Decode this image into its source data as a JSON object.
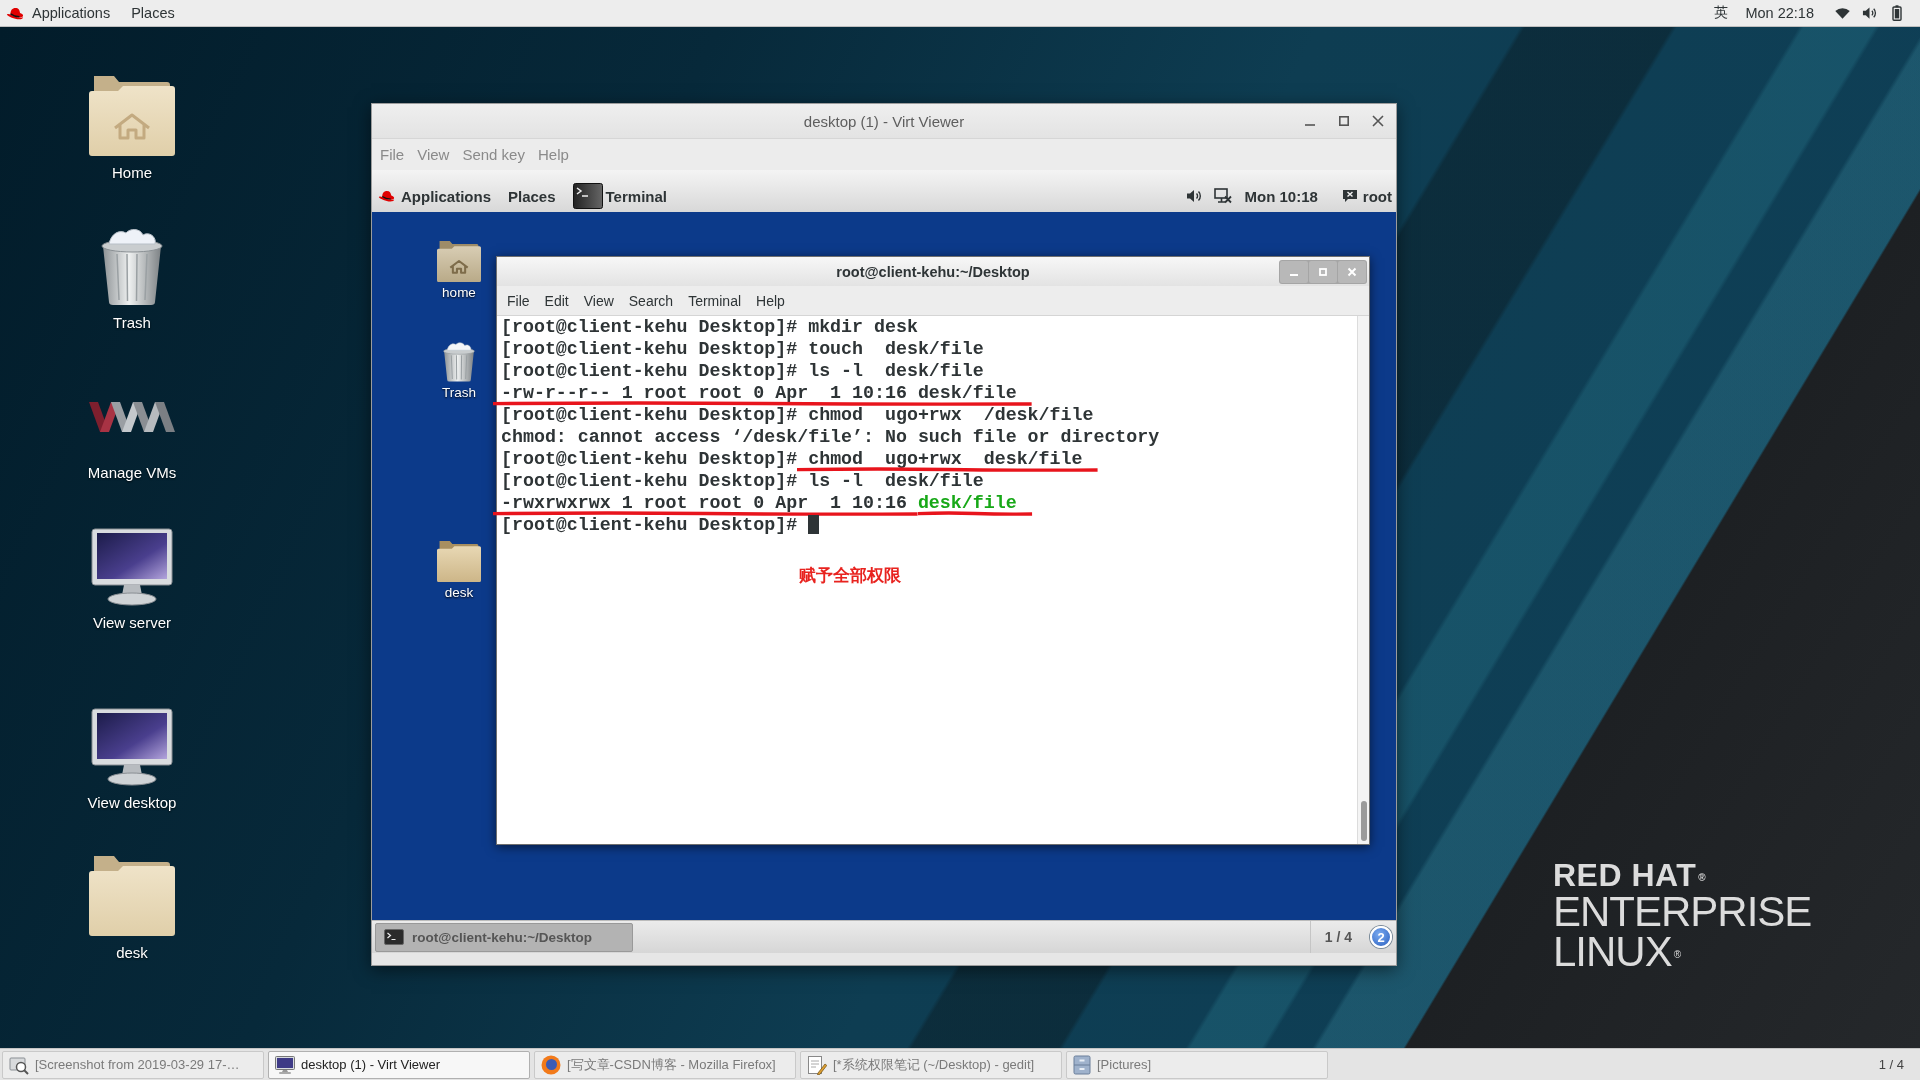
{
  "top_bar": {
    "menus": [
      "Applications",
      "Places"
    ],
    "input_method": "英",
    "clock": "Mon 22:18"
  },
  "desktop_icons": [
    {
      "label": "Home",
      "kind": "home-folder"
    },
    {
      "label": "Trash",
      "kind": "trash"
    },
    {
      "label": "Manage VMs",
      "kind": "vm-manager"
    },
    {
      "label": "View server",
      "kind": "monitor"
    },
    {
      "label": "View desktop",
      "kind": "monitor"
    },
    {
      "label": "desk",
      "kind": "folder"
    }
  ],
  "virt_viewer": {
    "title": "desktop (1) - Virt Viewer",
    "menu": [
      "File",
      "View",
      "Send key",
      "Help"
    ],
    "guest": {
      "top_bar": {
        "menus": [
          "Applications",
          "Places"
        ],
        "app": "Terminal",
        "clock": "Mon 10:18",
        "user": "root"
      },
      "desktop_icons": [
        {
          "label": "home",
          "kind": "home-folder"
        },
        {
          "label": "Trash",
          "kind": "trash"
        },
        {
          "label": "desk",
          "kind": "folder"
        }
      ],
      "terminal": {
        "title": "root@client-kehu:~/Desktop",
        "menu": [
          "File",
          "Edit",
          "View",
          "Search",
          "Terminal",
          "Help"
        ],
        "lines": [
          {
            "segments": [
              {
                "text": "[root@client-kehu Desktop]# mkdir desk",
                "kind": "plain",
                "underlined": false
              }
            ],
            "cursor": false
          },
          {
            "segments": [
              {
                "text": "[root@client-kehu Desktop]# touch  desk/file",
                "kind": "plain",
                "underlined": false
              }
            ],
            "cursor": false
          },
          {
            "segments": [
              {
                "text": "[root@client-kehu Desktop]# ls -l  desk/file",
                "kind": "plain",
                "underlined": false
              }
            ],
            "cursor": false
          },
          {
            "segments": [
              {
                "text": "-rw-r--r-- 1 root root 0 Apr  1 10:16 desk/file",
                "kind": "plain",
                "underlined": true
              }
            ],
            "cursor": false
          },
          {
            "segments": [
              {
                "text": "[root@client-kehu Desktop]# chmod  ugo+rwx  /desk/file",
                "kind": "plain",
                "underlined": false
              }
            ],
            "cursor": false
          },
          {
            "segments": [
              {
                "text": "chmod: cannot access ‘/desk/file’: No such file or directory",
                "kind": "plain",
                "underlined": false
              }
            ],
            "cursor": false
          },
          {
            "segments": [
              {
                "text": "[root@client-kehu Desktop]#",
                "kind": "plain",
                "underlined": false
              },
              {
                "text": " chmod  ugo+rwx  desk/file",
                "kind": "plain",
                "underlined": true
              }
            ],
            "cursor": false
          },
          {
            "segments": [
              {
                "text": "[root@client-kehu Desktop]# ls -l  desk/file",
                "kind": "plain",
                "underlined": false
              }
            ],
            "cursor": false
          },
          {
            "segments": [
              {
                "text": "-rwxrwxrwx 1 root root 0 Apr  1 10:16 ",
                "kind": "plain",
                "underlined": true
              },
              {
                "text": "desk/file",
                "kind": "executable",
                "underlined": true
              }
            ],
            "cursor": false
          },
          {
            "segments": [
              {
                "text": "[root@client-kehu Desktop]#",
                "kind": "plain",
                "underlined": false
              }
            ],
            "cursor": true
          }
        ],
        "annotation": "赋予全部权限"
      },
      "taskbar": {
        "windows": [
          {
            "label": "root@client-kehu:~/Desktop",
            "selected": true
          }
        ],
        "workspace": "1 / 4",
        "badge": "2"
      }
    }
  },
  "logo": {
    "lines": [
      {
        "text": "RED HAT$^{®}$",
        "kind": "heavy"
      },
      {
        "text": "ENTERPRISE",
        "kind": "light"
      },
      {
        "text": "LINUX$^{®}$",
        "kind": "light"
      }
    ]
  },
  "taskbar": {
    "windows": [
      {
        "label": "[Screenshot from 2019-03-29 17-…",
        "kind": "screenshot",
        "selected": false
      },
      {
        "label": "desktop (1) - Virt Viewer",
        "kind": "viewer",
        "selected": true
      },
      {
        "label": "[写文章-CSDN博客 - Mozilla Firefox]",
        "kind": "browser",
        "selected": false
      },
      {
        "label": "[*系统权限笔记 (~/Desktop) - gedit]",
        "kind": "editor",
        "selected": false
      },
      {
        "label": "[Pictures]",
        "kind": "files",
        "selected": false
      }
    ],
    "workspace": "1 / 4"
  }
}
